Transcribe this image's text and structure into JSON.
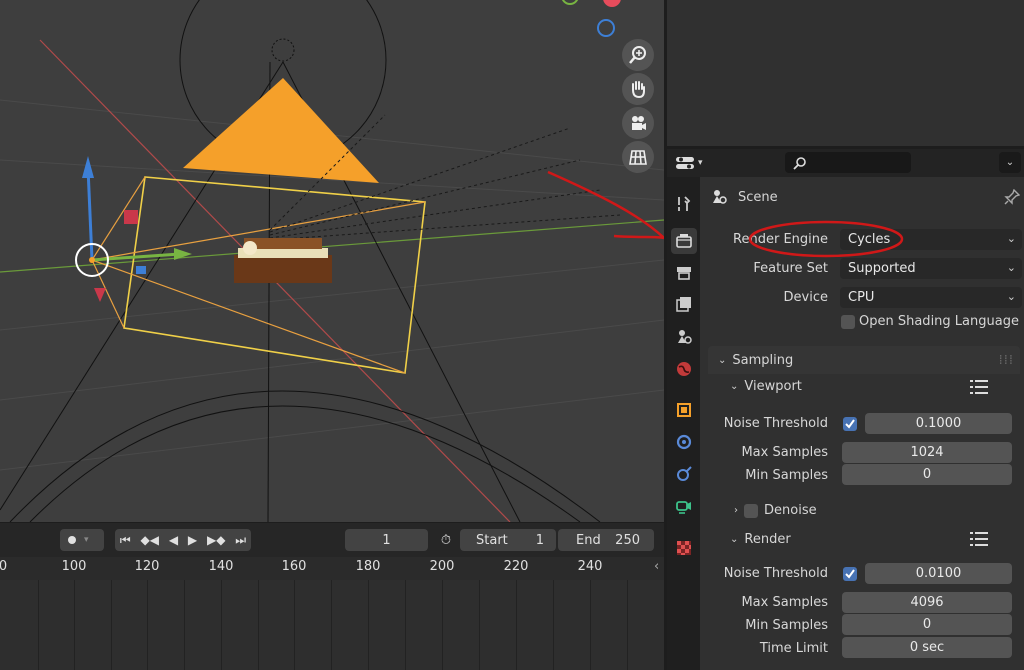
{
  "viewport": {
    "nav_buttons": [
      "zoom-icon",
      "hand-pan-icon",
      "camera-view-icon",
      "grid-ortho-icon"
    ],
    "gizmo_colors": {
      "x": "#e74c5c",
      "y": "#78b442",
      "z": "#3d7fd6"
    }
  },
  "timeline": {
    "current_frame": "1",
    "start_label": "Start",
    "start_value": "1",
    "end_label": "End",
    "end_value": "250",
    "ruler_ticks": [
      "0",
      "100",
      "120",
      "140",
      "160",
      "180",
      "200",
      "220",
      "240"
    ]
  },
  "properties": {
    "search_placeholder": "",
    "context": "Scene",
    "render_engine_label": "Render Engine",
    "render_engine_value": "Cycles",
    "feature_set_label": "Feature Set",
    "feature_set_value": "Supported",
    "device_label": "Device",
    "device_value": "CPU",
    "osl_label": "Open Shading Language",
    "sampling": {
      "title": "Sampling",
      "viewport": {
        "title": "Viewport",
        "noise_threshold_label": "Noise Threshold",
        "noise_threshold_value": "0.1000",
        "max_samples_label": "Max Samples",
        "max_samples_value": "1024",
        "min_samples_label": "Min Samples",
        "min_samples_value": "0"
      },
      "denoise_label": "Denoise",
      "render": {
        "title": "Render",
        "noise_threshold_label": "Noise Threshold",
        "noise_threshold_value": "0.0100",
        "max_samples_label": "Max Samples",
        "max_samples_value": "4096",
        "min_samples_label": "Min Samples",
        "min_samples_value": "0",
        "time_limit_label": "Time Limit",
        "time_limit_value": "0 sec"
      }
    },
    "tab_icons": [
      "tool-icon",
      "render-icon",
      "output-icon",
      "view-layer-icon",
      "scene-icon",
      "world-icon",
      "object-icon",
      "modifier-icon",
      "particles-icon",
      "physics-icon",
      "texture-icon"
    ],
    "accent_color": "#4772b3",
    "annotation_color": "#d01818"
  }
}
